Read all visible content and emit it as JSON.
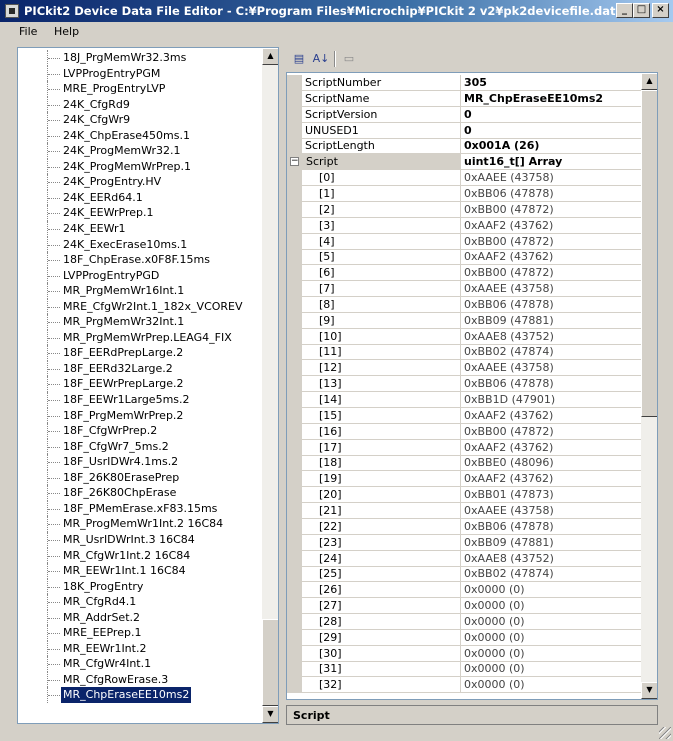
{
  "window": {
    "title": "PICkit2 Device Data File Editor - C:¥Program Files¥Microchip¥PICkit 2 v2¥pk2devicefile.dat",
    "min": "_",
    "max": "□",
    "close": "×"
  },
  "menu": {
    "file": "File",
    "help": "Help"
  },
  "scripts_list": {
    "items": [
      "18J_PrgMemWr32.3ms",
      "LVPProgEntryPGM",
      "MRE_ProgEntryLVP",
      "24K_CfgRd9",
      "24K_CfgWr9",
      "24K_ChpErase450ms.1",
      "24K_ProgMemWr32.1",
      "24K_ProgMemWrPrep.1",
      "24K_ProgEntry.HV",
      "24K_EERd64.1",
      "24K_EEWrPrep.1",
      "24K_EEWr1",
      "24K_ExecErase10ms.1",
      "18F_ChpErase.x0F8F.15ms",
      "LVPProgEntryPGD",
      "MR_PrgMemWr16Int.1",
      "MRE_CfgWr2Int.1_182x_VCOREV",
      "MR_PrgMemWr32Int.1",
      "MR_PrgMemWrPrep.LEAG4_FIX",
      "18F_EERdPrepLarge.2",
      "18F_EERd32Large.2",
      "18F_EEWrPrepLarge.2",
      "18F_EEWr1Large5ms.2",
      "18F_PrgMemWrPrep.2",
      "18F_CfgWrPrep.2",
      "18F_CfgWr7_5ms.2",
      "18F_UsrIDWr4.1ms.2",
      "18F_26K80ErasePrep",
      "18F_26K80ChpErase",
      "18F_PMemErase.xF83.15ms",
      "MR_ProgMemWr1Int.2 16C84",
      "MR_UsrIDWrInt.3 16C84",
      "MR_CfgWr1Int.2 16C84",
      "MR_EEWr1Int.1 16C84",
      "18K_ProgEntry",
      "MR_CfgRd4.1",
      "MR_AddrSet.2",
      "MRE_EEPrep.1",
      "MR_EEWr1Int.2",
      "MR_CfgWr4Int.1",
      "MR_CfgRowErase.3",
      "MR_ChpEraseEE10ms2"
    ],
    "selected_index": 41
  },
  "toolbar": {
    "categorized_icon": "▤",
    "alphabetical_icon": "A↓",
    "pages_icon": "▭"
  },
  "property_grid": {
    "properties": [
      {
        "name": "ScriptNumber",
        "value": "305"
      },
      {
        "name": "ScriptName",
        "value": "MR_ChpEraseEE10ms2"
      },
      {
        "name": "ScriptVersion",
        "value": "0"
      },
      {
        "name": "UNUSED1",
        "value": "0"
      },
      {
        "name": "ScriptLength",
        "value": "0x001A (26)"
      }
    ],
    "script": {
      "name": "Script",
      "value": "uint16_t[] Array",
      "expander": "−"
    },
    "array_items": [
      {
        "index": "[0]",
        "value": "0xAAEE (43758)"
      },
      {
        "index": "[1]",
        "value": "0xBB06 (47878)"
      },
      {
        "index": "[2]",
        "value": "0xBB00 (47872)"
      },
      {
        "index": "[3]",
        "value": "0xAAF2 (43762)"
      },
      {
        "index": "[4]",
        "value": "0xBB00 (47872)"
      },
      {
        "index": "[5]",
        "value": "0xAAF2 (43762)"
      },
      {
        "index": "[6]",
        "value": "0xBB00 (47872)"
      },
      {
        "index": "[7]",
        "value": "0xAAEE (43758)"
      },
      {
        "index": "[8]",
        "value": "0xBB06 (47878)"
      },
      {
        "index": "[9]",
        "value": "0xBB09 (47881)"
      },
      {
        "index": "[10]",
        "value": "0xAAE8 (43752)"
      },
      {
        "index": "[11]",
        "value": "0xBB02 (47874)"
      },
      {
        "index": "[12]",
        "value": "0xAAEE (43758)"
      },
      {
        "index": "[13]",
        "value": "0xBB06 (47878)"
      },
      {
        "index": "[14]",
        "value": "0xBB1D (47901)"
      },
      {
        "index": "[15]",
        "value": "0xAAF2 (43762)"
      },
      {
        "index": "[16]",
        "value": "0xBB00 (47872)"
      },
      {
        "index": "[17]",
        "value": "0xAAF2 (43762)"
      },
      {
        "index": "[18]",
        "value": "0xBBE0 (48096)"
      },
      {
        "index": "[19]",
        "value": "0xAAF2 (43762)"
      },
      {
        "index": "[20]",
        "value": "0xBB01 (47873)"
      },
      {
        "index": "[21]",
        "value": "0xAAEE (43758)"
      },
      {
        "index": "[22]",
        "value": "0xBB06 (47878)"
      },
      {
        "index": "[23]",
        "value": "0xBB09 (47881)"
      },
      {
        "index": "[24]",
        "value": "0xAAE8 (43752)"
      },
      {
        "index": "[25]",
        "value": "0xBB02 (47874)"
      },
      {
        "index": "[26]",
        "value": "0x0000 (0)"
      },
      {
        "index": "[27]",
        "value": "0x0000 (0)"
      },
      {
        "index": "[28]",
        "value": "0x0000 (0)"
      },
      {
        "index": "[29]",
        "value": "0x0000 (0)"
      },
      {
        "index": "[30]",
        "value": "0x0000 (0)"
      },
      {
        "index": "[31]",
        "value": "0x0000 (0)"
      },
      {
        "index": "[32]",
        "value": "0x0000 (0)"
      }
    ]
  },
  "description": {
    "title": "Script"
  },
  "scrollbar": {
    "up": "▲",
    "down": "▼"
  }
}
